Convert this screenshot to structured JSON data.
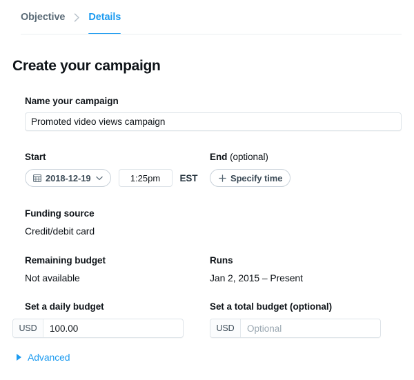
{
  "breadcrumb": {
    "objective_label": "Objective",
    "details_label": "Details",
    "separator_icon": "chevron-right-icon",
    "active": "Details",
    "accent_color": "#1d9bf0"
  },
  "page": {
    "title": "Create your campaign"
  },
  "name_section": {
    "label": "Name your campaign",
    "value": "Promoted video views campaign",
    "placeholder": "Name your campaign"
  },
  "schedule": {
    "start": {
      "label": "Start",
      "date_value": "2018-12-19",
      "date_icon": "calendar-icon",
      "chevron_icon": "chevron-down-icon",
      "time_value": "1:25pm",
      "time_placeholder": "1:25pm",
      "timezone": "EST"
    },
    "end": {
      "label": "End",
      "label_suffix": "(optional)",
      "specify_button_label": "Specify time",
      "plus_icon": "plus-icon"
    }
  },
  "funding": {
    "label": "Funding source",
    "value": "Credit/debit card"
  },
  "remaining_budget": {
    "label": "Remaining budget",
    "value": "Not available"
  },
  "runs": {
    "label": "Runs",
    "value": "Jan 2, 2015 – Present"
  },
  "daily_budget": {
    "label": "Set a daily budget",
    "currency": "USD",
    "value": "100.00",
    "placeholder": ""
  },
  "total_budget": {
    "label": "Set a total budget (optional)",
    "currency": "USD",
    "value": "",
    "placeholder": "Optional"
  },
  "advanced": {
    "label": "Advanced",
    "icon": "triangle-right-icon",
    "expanded": false
  }
}
